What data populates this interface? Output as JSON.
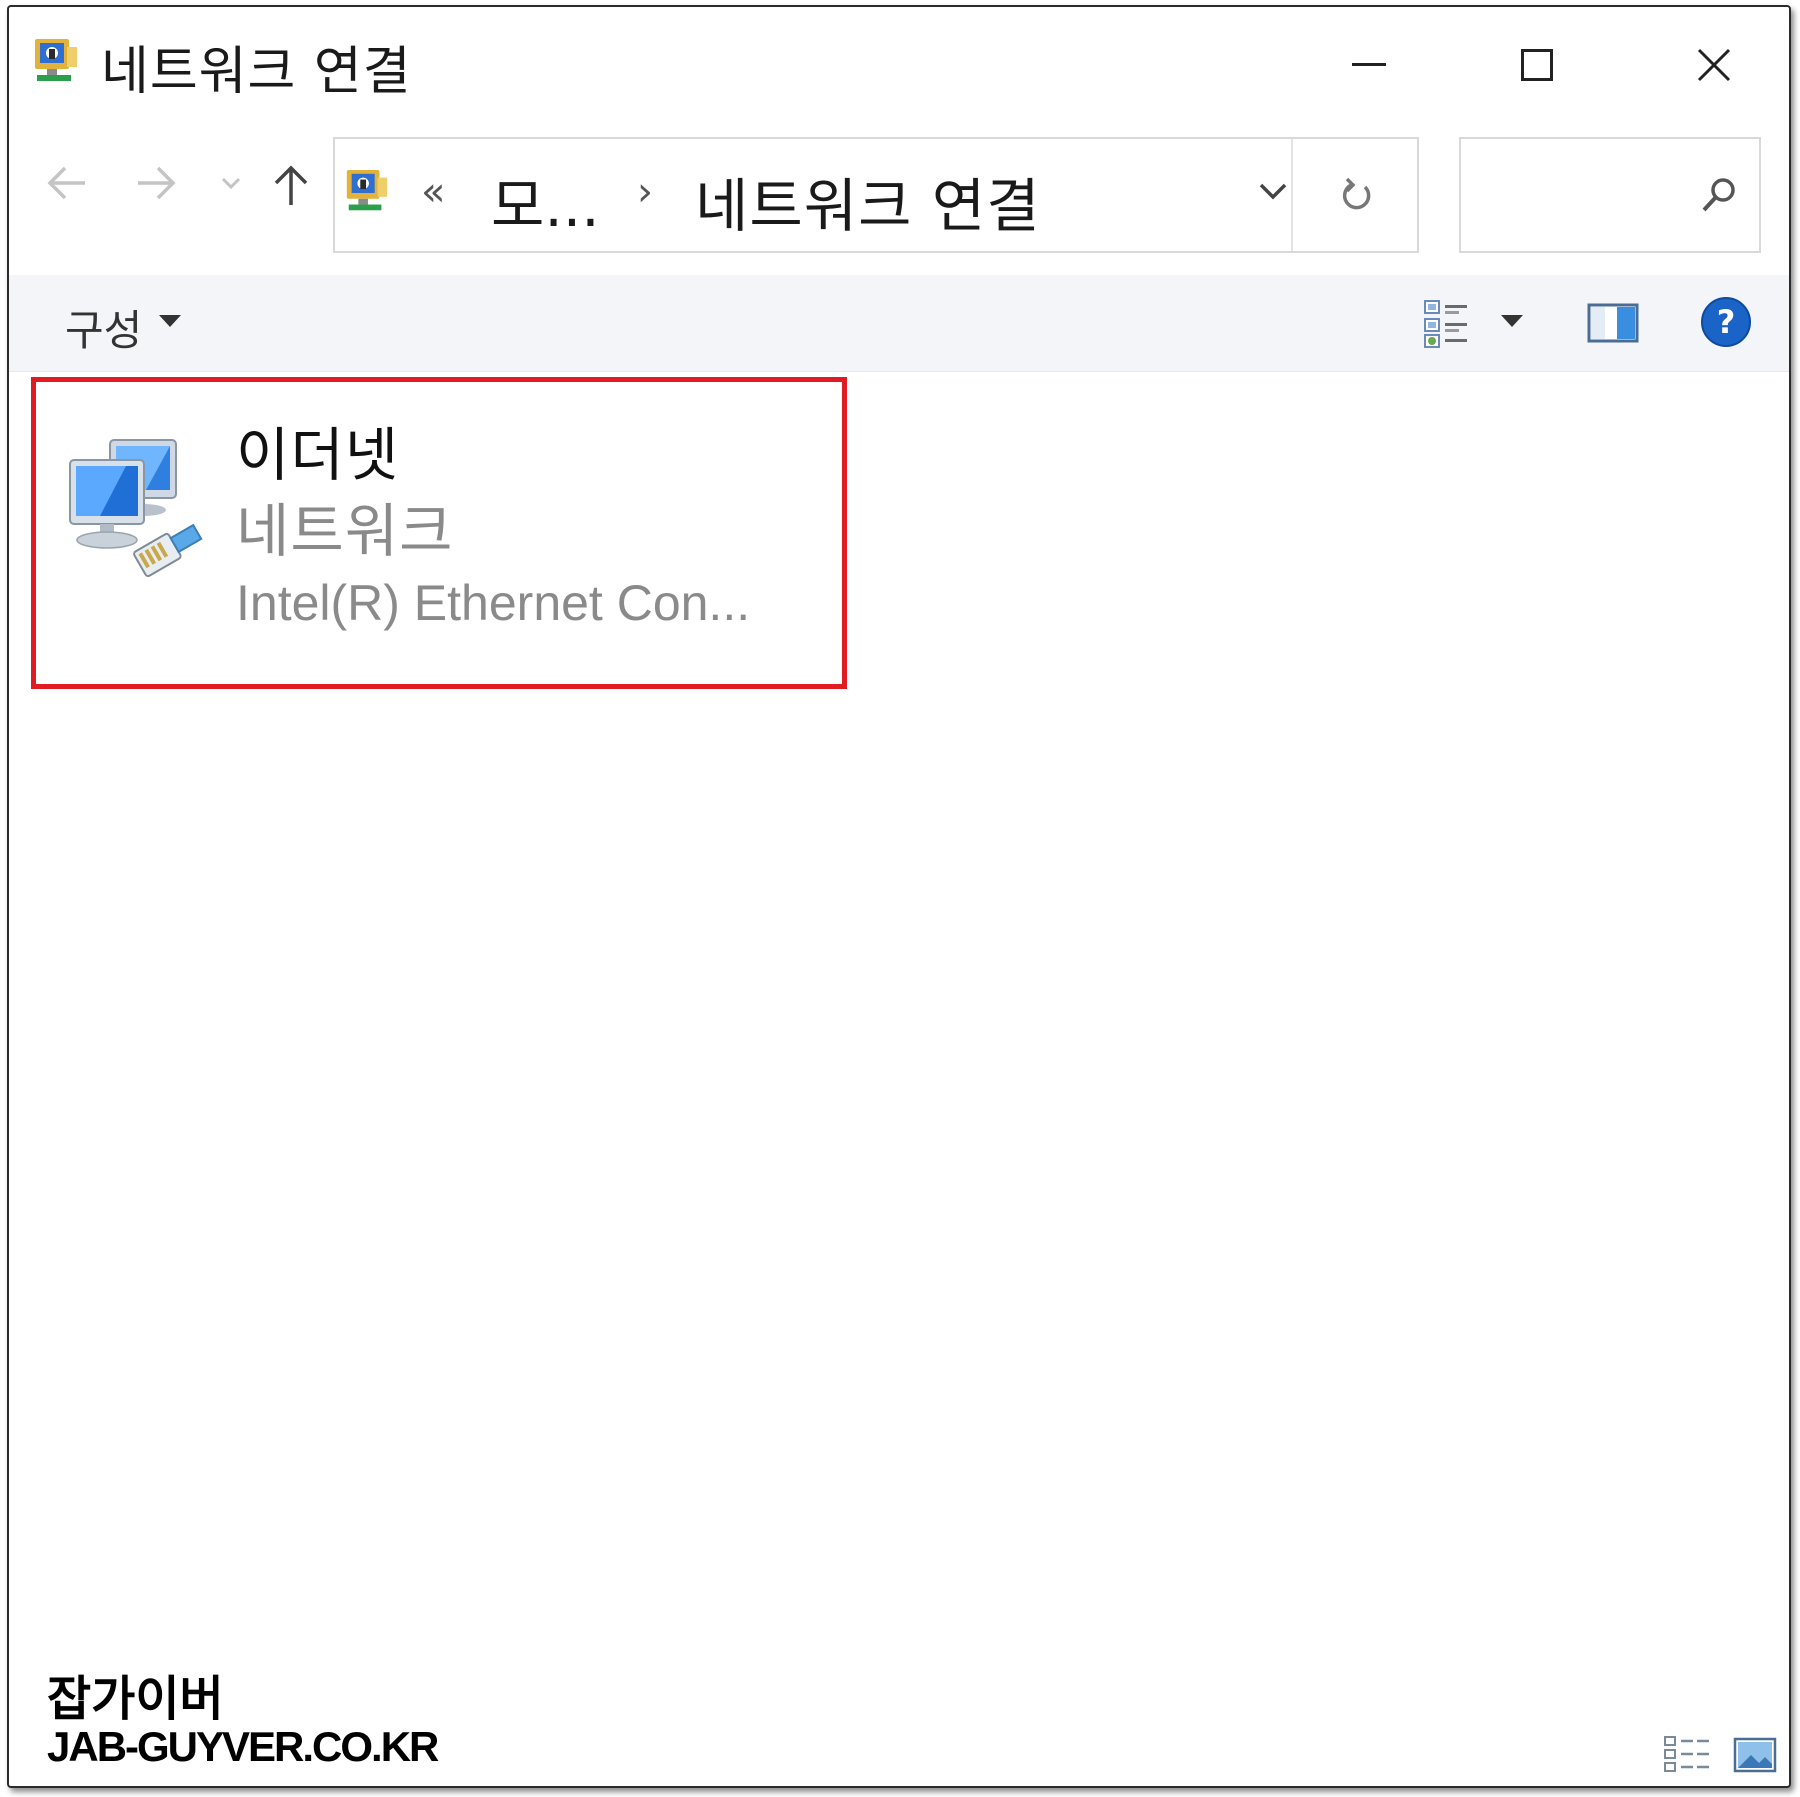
{
  "window": {
    "title": "네트워크 연결"
  },
  "address_bar": {
    "overflow_chevron": "«",
    "crumbs": [
      "모...",
      "네트워크 연결"
    ],
    "separator": "›"
  },
  "search": {
    "placeholder": ""
  },
  "command_bar": {
    "organize_label": "구성",
    "help_glyph": "?"
  },
  "items": [
    {
      "name": "이더넷",
      "status": "네트워크",
      "device": "Intel(R) Ethernet Con..."
    }
  ],
  "highlight_color": "#e11b22",
  "watermark": {
    "line1": "잡가이버",
    "line2": "JAB-GUYVER.CO.KR"
  }
}
